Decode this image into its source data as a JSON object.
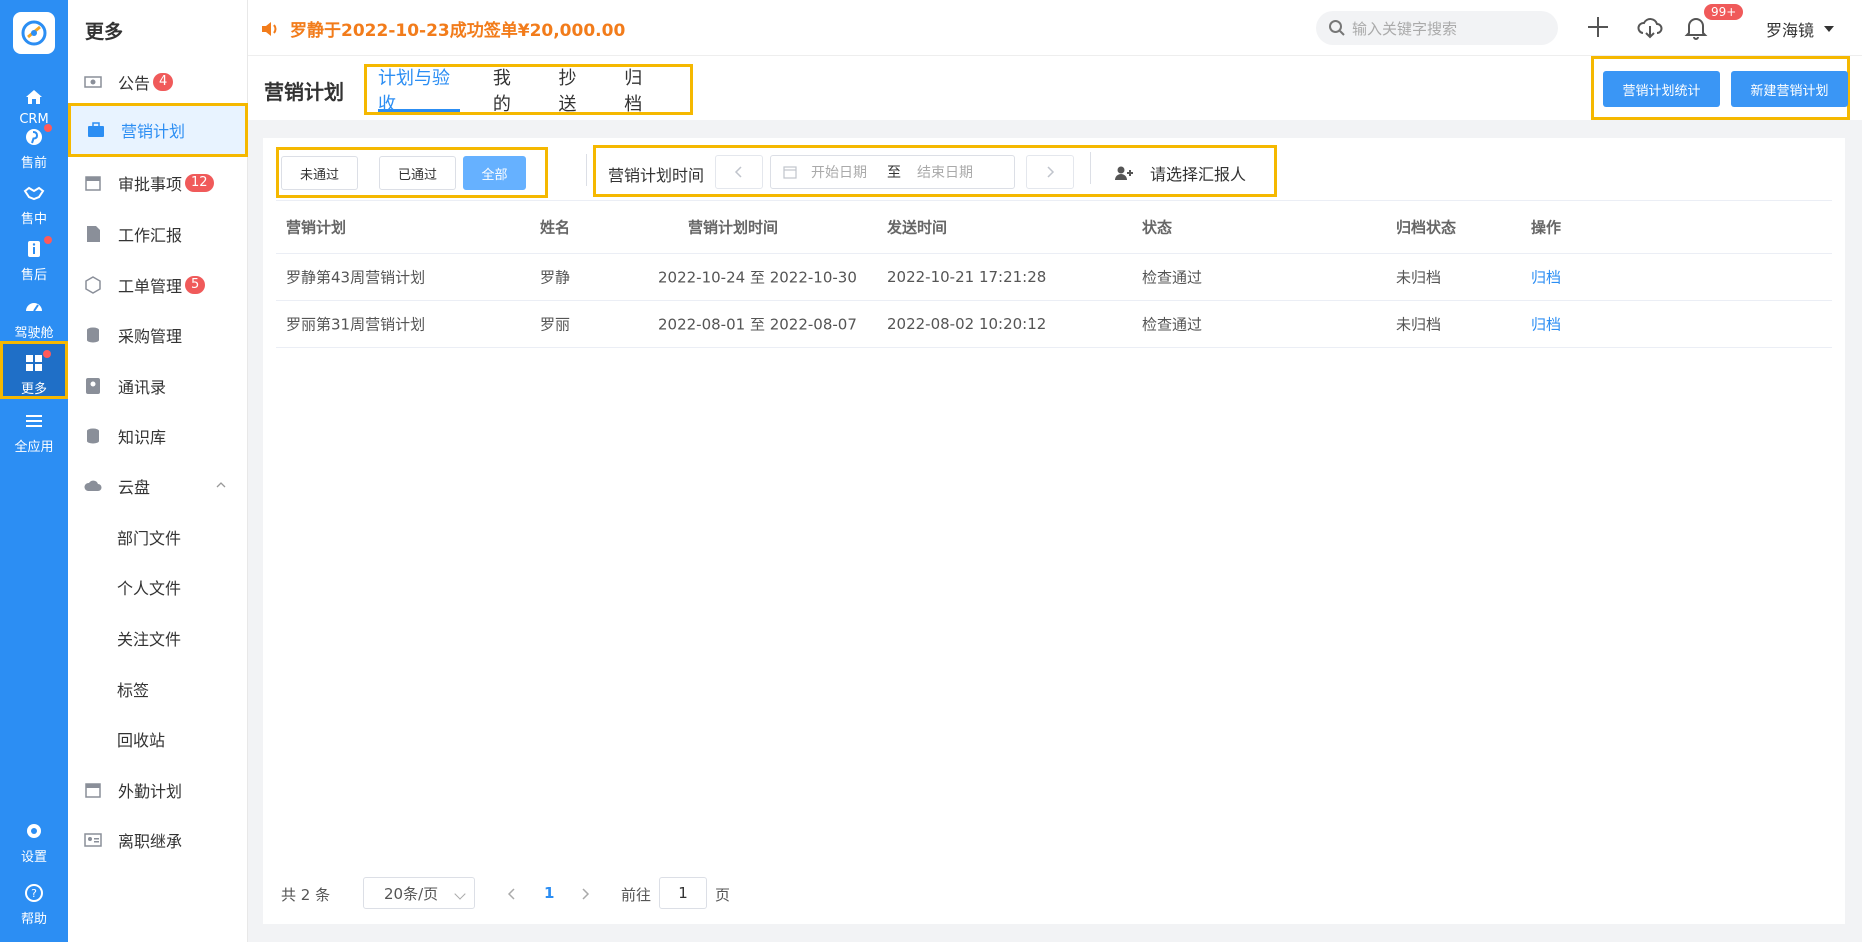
{
  "rail": {
    "items": [
      {
        "label": "CRM",
        "icon": "home-icon"
      },
      {
        "label": "售前",
        "icon": "pin-icon"
      },
      {
        "label": "售中",
        "icon": "handshake-icon"
      },
      {
        "label": "售后",
        "icon": "info-icon"
      },
      {
        "label": "驾驶舱",
        "icon": "dashboard-icon"
      },
      {
        "label": "更多",
        "icon": "grid-icon"
      },
      {
        "label": "全应用",
        "icon": "menu-icon"
      },
      {
        "label": "设置",
        "icon": "gear-icon"
      },
      {
        "label": "帮助",
        "icon": "help-icon"
      }
    ]
  },
  "sidebar": {
    "title": "更多",
    "items": [
      {
        "label": "公告",
        "badge": "4"
      },
      {
        "label": "营销计划"
      },
      {
        "label": "审批事项",
        "badge": "12"
      },
      {
        "label": "工作汇报"
      },
      {
        "label": "工单管理",
        "badge": "5"
      },
      {
        "label": "采购管理"
      },
      {
        "label": "通讯录"
      },
      {
        "label": "知识库"
      },
      {
        "label": "云盘"
      },
      {
        "label": "部门文件"
      },
      {
        "label": "个人文件"
      },
      {
        "label": "关注文件"
      },
      {
        "label": "标签"
      },
      {
        "label": "回收站"
      },
      {
        "label": "外勤计划"
      },
      {
        "label": "离职继承"
      }
    ]
  },
  "topbar": {
    "notice": "罗静于2022-10-23成功签单¥20,000.00",
    "search_placeholder": "输入关键字搜索",
    "bell_badge": "99+",
    "user": "罗海镜"
  },
  "header": {
    "title": "营销计划",
    "tabs": [
      "计划与验收",
      "我的",
      "抄送",
      "归档"
    ],
    "btn_stats": "营销计划统计",
    "btn_new": "新建营销计划"
  },
  "filters": {
    "not_passed": "未通过",
    "passed": "已通过",
    "all": "全部",
    "time_label": "营销计划时间",
    "start_placeholder": "开始日期",
    "range_sep": "至",
    "end_placeholder": "结束日期",
    "reporter": "请选择汇报人"
  },
  "table": {
    "headers": [
      "营销计划",
      "姓名",
      "营销计划时间",
      "发送时间",
      "状态",
      "归档状态",
      "操作"
    ],
    "rows": [
      {
        "plan": "罗静第43周营销计划",
        "name": "罗静",
        "period": "2022-10-24 至 2022-10-30",
        "sent": "2022-10-21 17:21:28",
        "status": "检查通过",
        "archive": "未归档",
        "action": "归档"
      },
      {
        "plan": "罗丽第31周营销计划",
        "name": "罗丽",
        "period": "2022-08-01 至 2022-08-07",
        "sent": "2022-08-02 10:20:12",
        "status": "检查通过",
        "archive": "未归档",
        "action": "归档"
      }
    ]
  },
  "pager": {
    "total": "共 2 条",
    "size": "20条/页",
    "page": "1",
    "goto_pre": "前往",
    "goto_val": "1",
    "goto_post": "页"
  },
  "colors": {
    "primary": "#2c8ef3",
    "highlight": "#f5b800",
    "notice": "#f27c1b",
    "badge": "#f05a5a"
  }
}
